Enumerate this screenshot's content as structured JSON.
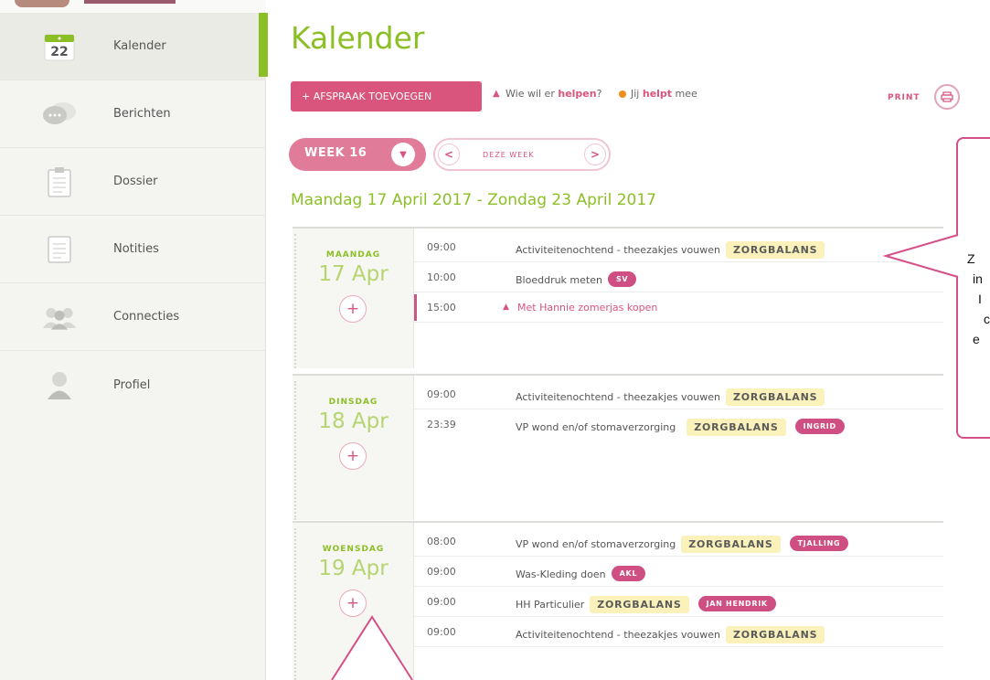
{
  "sidebar": {
    "items": [
      {
        "label": "Kalender",
        "icon": "calendar-icon",
        "badge": "22",
        "active": true
      },
      {
        "label": "Berichten",
        "icon": "chat-bubbles-icon"
      },
      {
        "label": "Dossier",
        "icon": "clipboard-icon"
      },
      {
        "label": "Notities",
        "icon": "notes-icon"
      },
      {
        "label": "Connecties",
        "icon": "people-icon"
      },
      {
        "label": "Profiel",
        "icon": "user-icon"
      }
    ]
  },
  "header": {
    "title": "Kalender",
    "add_button": "+ AFSPRAAK TOEVOEGEN",
    "legend_help_prefix": "Wie wil er ",
    "legend_help_bold": "helpen",
    "legend_help_suffix": "?",
    "legend_joins_prefix": "Jij ",
    "legend_joins_bold": "helpt",
    "legend_joins_suffix": " mee",
    "print_label": "PRINT",
    "print_icon": "printer-icon"
  },
  "week_nav": {
    "week_label": "WEEK 16",
    "this_week": "DEZE WEEK",
    "prev_icon": "chevron-left-icon",
    "next_icon": "chevron-right-icon",
    "dropdown_icon": "chevron-down-icon"
  },
  "date_range": "Maandag 17 April 2017 - Zondag 23 April 2017",
  "days": [
    {
      "name": "MAANDAG",
      "date": "17 Apr",
      "events": [
        {
          "time": "09:00",
          "title": "Activiteitenochtend - theezakjes vouwen",
          "badge": "ZORGBALANS"
        },
        {
          "time": "10:00",
          "title": "Bloeddruk meten",
          "tag": "SV"
        },
        {
          "time": "15:00",
          "title": "Met Hannie zomerjas kopen",
          "help": true
        }
      ]
    },
    {
      "name": "DINSDAG",
      "date": "18 Apr",
      "events": [
        {
          "time": "09:00",
          "title": "Activiteitenochtend - theezakjes vouwen",
          "badge": "ZORGBALANS"
        },
        {
          "time": "23:39",
          "title": "VP wond en/of stomaverzorging",
          "badge": "ZORGBALANS",
          "tag": "INGRID"
        }
      ]
    },
    {
      "name": "WOENSDAG",
      "date": "19 Apr",
      "events": [
        {
          "time": "08:00",
          "title": "VP wond en/of stomaverzorging",
          "badge": "ZORGBALANS",
          "tag": "TJALLING"
        },
        {
          "time": "09:00",
          "title": "Was-Kleding doen",
          "tag": "AKL"
        },
        {
          "time": "09:00",
          "title": "HH Particulier",
          "badge": "ZORGBALANS",
          "tag": "JAN HENDRIK"
        },
        {
          "time": "09:00",
          "title": "Activiteitenochtend - theezakjes vouwen",
          "badge": "ZORGBALANS"
        }
      ]
    }
  ],
  "callout": {
    "lines": [
      "Z",
      "in",
      "I",
      "c",
      "e"
    ]
  },
  "colors": {
    "green": "#8cbf26",
    "pink": "#d9557d",
    "zorgbalans_badge": "#fbf1ba"
  }
}
